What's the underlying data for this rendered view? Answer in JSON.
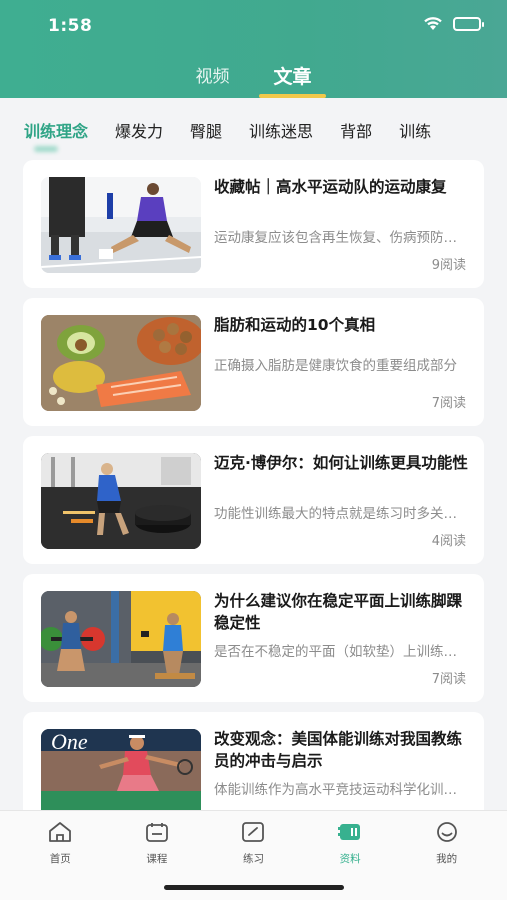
{
  "status_bar": {
    "time": "1:58"
  },
  "top_tabs": [
    {
      "label": "视频",
      "active": false
    },
    {
      "label": "文章",
      "active": true
    }
  ],
  "categories": [
    {
      "label": "训练理念",
      "active": true
    },
    {
      "label": "爆发力",
      "active": false
    },
    {
      "label": "臀腿",
      "active": false
    },
    {
      "label": "训练迷思",
      "active": false
    },
    {
      "label": "背部",
      "active": false
    },
    {
      "label": "训练",
      "active": false
    }
  ],
  "articles": [
    {
      "title": "收藏帖｜高水平运动队的运动康复",
      "desc": "运动康复应该包含再生恢复、伤病预防与处理",
      "reads": "9阅读",
      "thumb": "rehab"
    },
    {
      "title": "脂肪和运动的10个真相",
      "desc": "正确摄入脂肪是健康饮食的重要组成部分",
      "reads": "7阅读",
      "thumb": "food"
    },
    {
      "title": "迈克·博伊尔：如何让训练更具功能性",
      "desc": "功能性训练最大的特点就是练习时多关节参与",
      "reads": "4阅读",
      "thumb": "gym"
    },
    {
      "title": "为什么建议你在稳定平面上训练脚踝稳定性",
      "desc": "是否在不稳定的平面（如软垫）上训练脚踝",
      "reads": "7阅读",
      "thumb": "weights"
    },
    {
      "title": "改变观念：美国体能训练对我国教练员的冲击与启示",
      "desc": "体能训练作为高水平竞技运动科学化训练的重要组成",
      "reads": "",
      "thumb": "tennis"
    }
  ],
  "thumb_overlay": {
    "banner_text": "One"
  },
  "bottom_nav": [
    {
      "label": "首页",
      "icon": "home-icon",
      "active": false
    },
    {
      "label": "课程",
      "icon": "calendar-icon",
      "active": false
    },
    {
      "label": "练习",
      "icon": "practice-icon",
      "active": false
    },
    {
      "label": "资料",
      "icon": "library-icon",
      "active": true
    },
    {
      "label": "我的",
      "icon": "profile-icon",
      "active": false
    }
  ],
  "colors": {
    "accent": "#37b18f",
    "header": "#3fae91",
    "tab_underline": "#f1c84a"
  }
}
